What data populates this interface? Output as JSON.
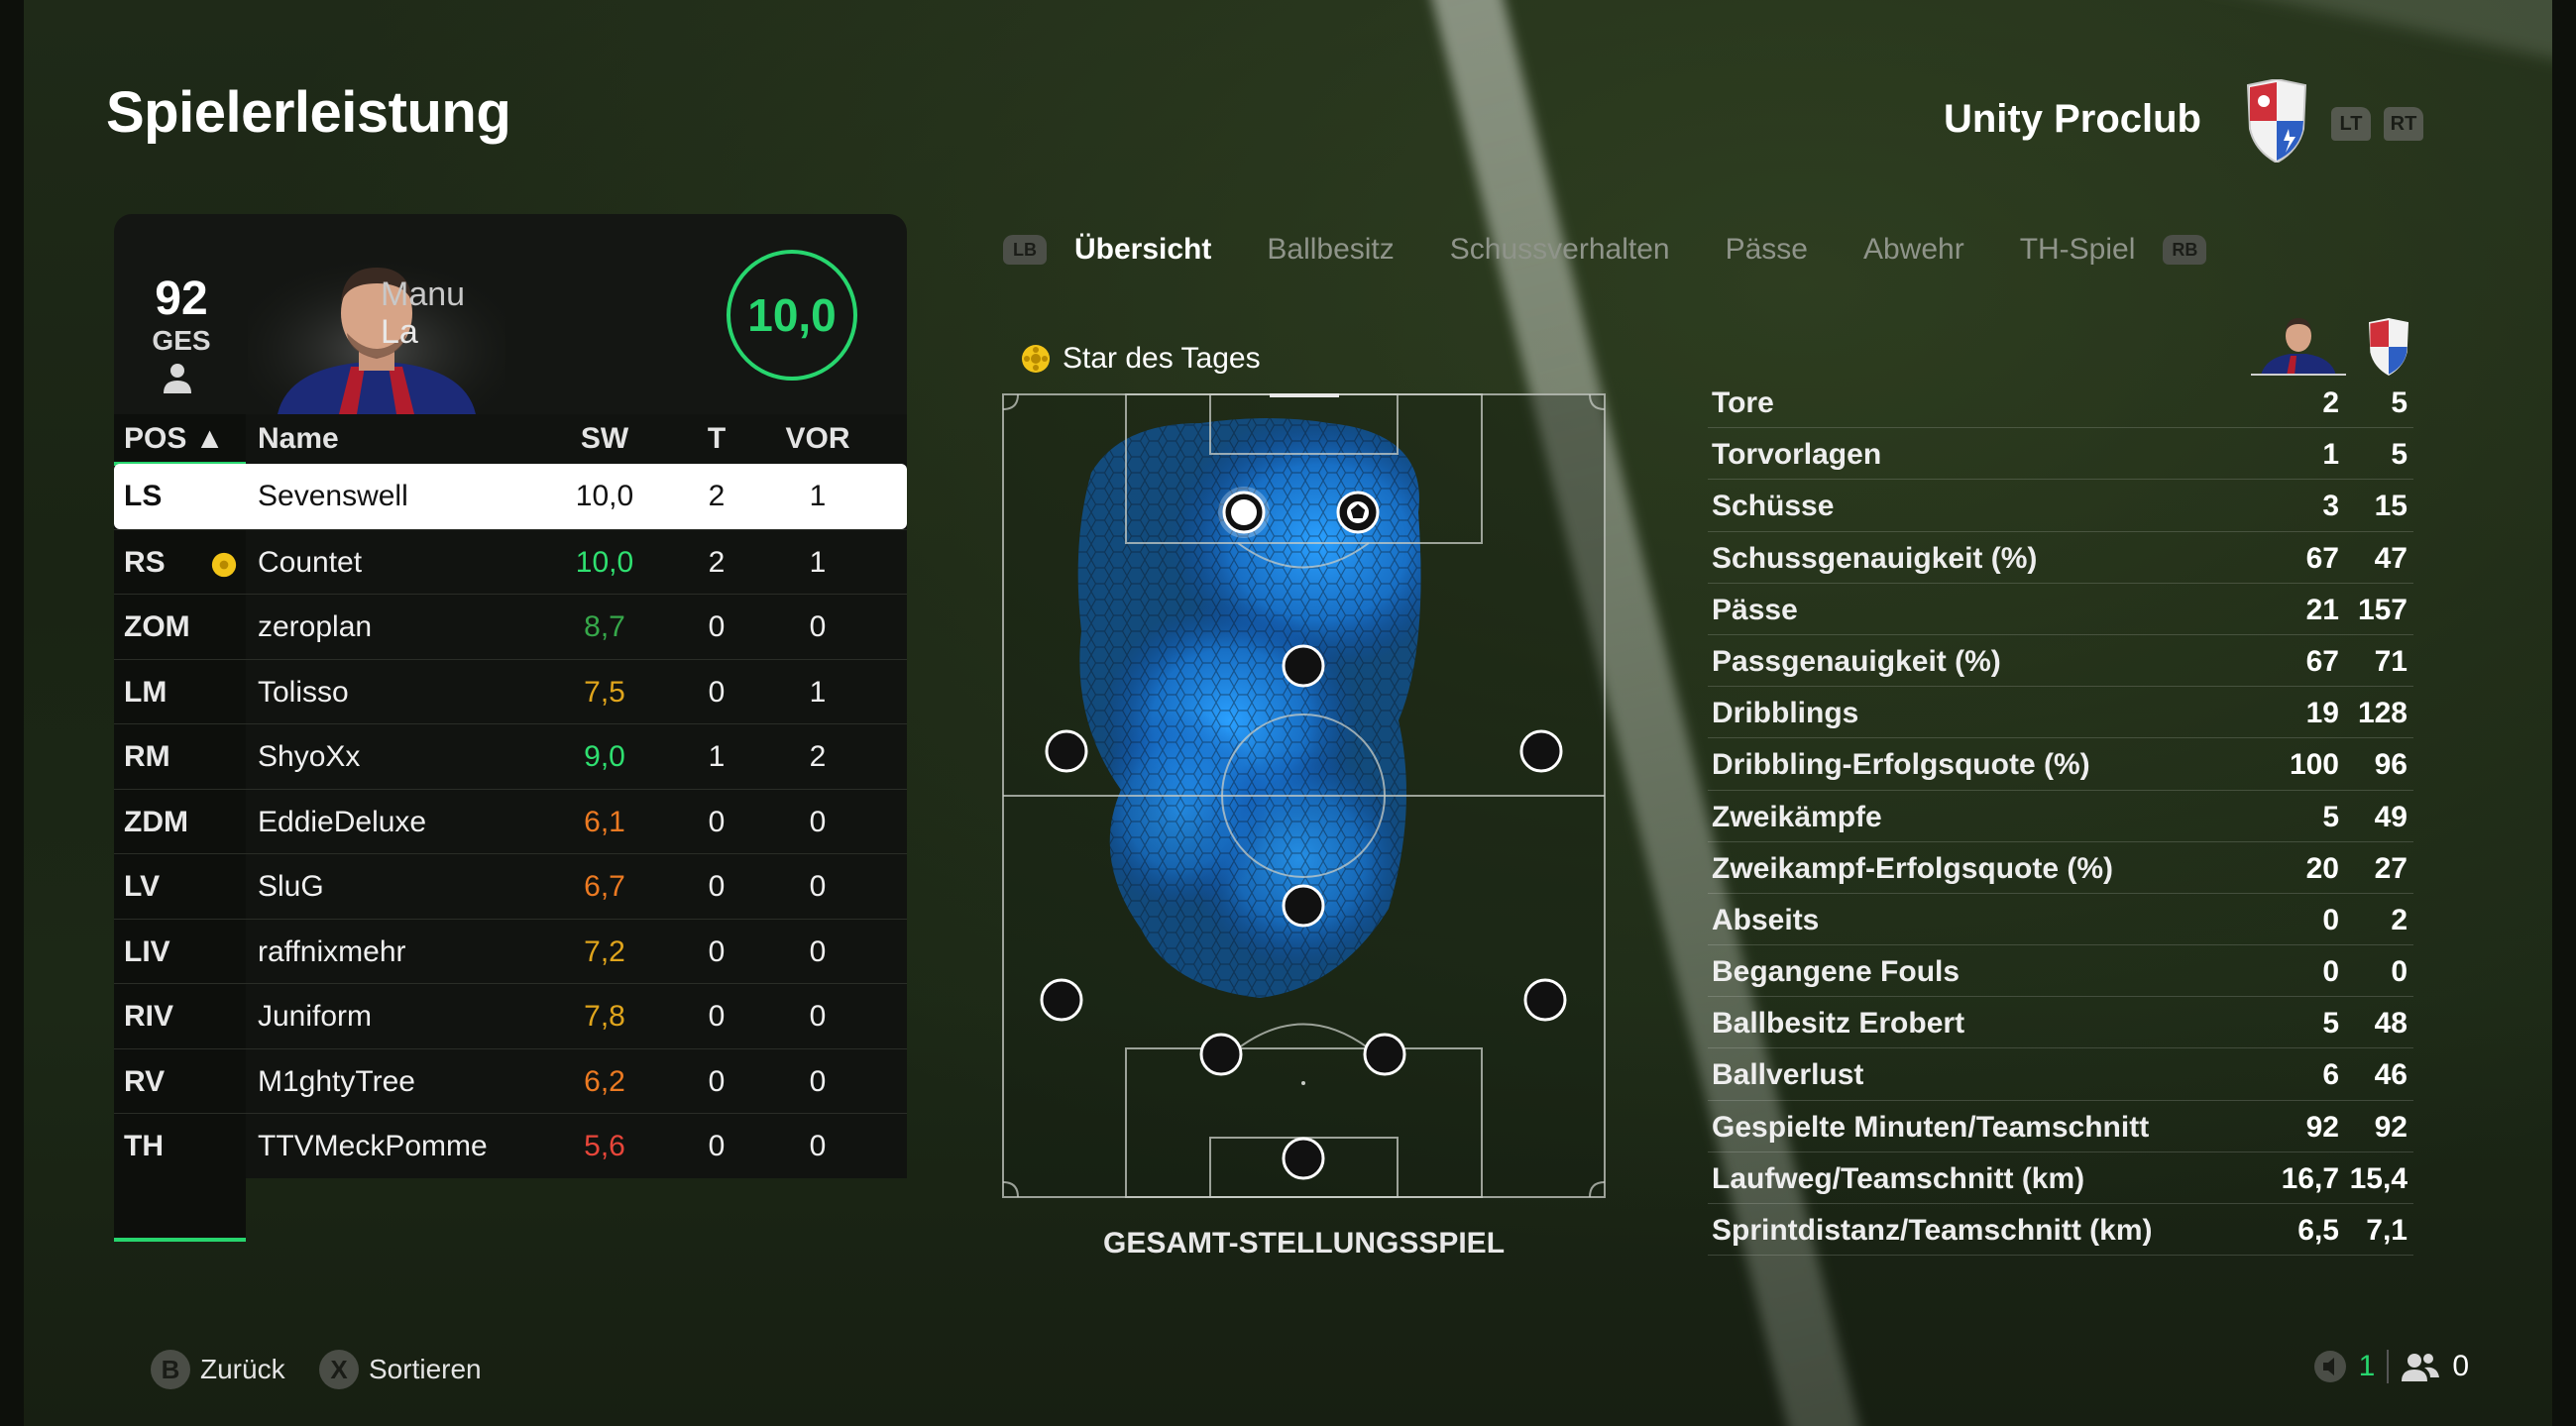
{
  "header": {
    "title": "Spielerleistung",
    "club_name": "Unity Proclub",
    "trigger_left": "LT",
    "trigger_right": "RT"
  },
  "player_card": {
    "overall": "92",
    "overall_label": "GES",
    "first_name": "Manu",
    "last_name": "La",
    "rating": "10,0"
  },
  "table": {
    "headers": {
      "pos": "POS ▲",
      "name": "Name",
      "sw": "SW",
      "t": "T",
      "vor": "VOR"
    },
    "rows": [
      {
        "pos": "LS",
        "name": "Sevenswell",
        "sw": "10,0",
        "t": "2",
        "vor": "1",
        "color": "#111111",
        "selected": true
      },
      {
        "pos": "RS",
        "name": "Countet",
        "sw": "10,0",
        "t": "2",
        "vor": "1",
        "color": "#2fe070",
        "star": true
      },
      {
        "pos": "ZOM",
        "name": "zeroplan",
        "sw": "8,7",
        "t": "0",
        "vor": "0",
        "color": "#36a84a"
      },
      {
        "pos": "LM",
        "name": "Tolisso",
        "sw": "7,5",
        "t": "0",
        "vor": "1",
        "color": "#e0a51c"
      },
      {
        "pos": "RM",
        "name": "ShyoXx",
        "sw": "9,0",
        "t": "1",
        "vor": "2",
        "color": "#2fe070"
      },
      {
        "pos": "ZDM",
        "name": "EddieDeluxe",
        "sw": "6,1",
        "t": "0",
        "vor": "0",
        "color": "#ec7a22"
      },
      {
        "pos": "LV",
        "name": "SluG",
        "sw": "6,7",
        "t": "0",
        "vor": "0",
        "color": "#ec7a22"
      },
      {
        "pos": "LIV",
        "name": "raffnixmehr",
        "sw": "7,2",
        "t": "0",
        "vor": "0",
        "color": "#e0a51c"
      },
      {
        "pos": "RIV",
        "name": "Juniform",
        "sw": "7,8",
        "t": "0",
        "vor": "0",
        "color": "#e0a51c"
      },
      {
        "pos": "RV",
        "name": "M1ghtyTree",
        "sw": "6,2",
        "t": "0",
        "vor": "0",
        "color": "#ec7a22"
      },
      {
        "pos": "TH",
        "name": "TTVMeckPomme",
        "sw": "5,6",
        "t": "0",
        "vor": "0",
        "color": "#e8463a"
      }
    ]
  },
  "tabs": {
    "bumper_left": "LB",
    "bumper_right": "RB",
    "items": [
      {
        "label": "Übersicht",
        "active": true
      },
      {
        "label": "Ballbesitz"
      },
      {
        "label": "Schussverhalten"
      },
      {
        "label": "Pässe"
      },
      {
        "label": "Abwehr"
      },
      {
        "label": "TH-Spiel"
      }
    ]
  },
  "pitch": {
    "star_label": "Star des Tages",
    "caption": "GESAMT-STELLUNGSSPIEL"
  },
  "stats": [
    {
      "label": "Tore",
      "player": "2",
      "team": "5"
    },
    {
      "label": "Torvorlagen",
      "player": "1",
      "team": "5"
    },
    {
      "label": "Schüsse",
      "player": "3",
      "team": "15"
    },
    {
      "label": "Schussgenauigkeit (%)",
      "player": "67",
      "team": "47"
    },
    {
      "label": "Pässe",
      "player": "21",
      "team": "157"
    },
    {
      "label": "Passgenauigkeit (%)",
      "player": "67",
      "team": "71"
    },
    {
      "label": "Dribblings",
      "player": "19",
      "team": "128"
    },
    {
      "label": "Dribbling-Erfolgsquote (%)",
      "player": "100",
      "team": "96"
    },
    {
      "label": "Zweikämpfe",
      "player": "5",
      "team": "49"
    },
    {
      "label": "Zweikampf-Erfolgsquote (%)",
      "player": "20",
      "team": "27"
    },
    {
      "label": "Abseits",
      "player": "0",
      "team": "2"
    },
    {
      "label": "Begangene Fouls",
      "player": "0",
      "team": "0"
    },
    {
      "label": "Ballbesitz Erobert",
      "player": "5",
      "team": "48"
    },
    {
      "label": "Ballverlust",
      "player": "6",
      "team": "46"
    },
    {
      "label": "Gespielte Minuten/Teamschnitt",
      "player": "92",
      "team": "92"
    },
    {
      "label": "Laufweg/Teamschnitt (km)",
      "player": "16,7",
      "team": "15,4"
    },
    {
      "label": "Sprintdistanz/Teamschnitt (km)",
      "player": "6,5",
      "team": "7,1"
    }
  ],
  "footer": {
    "back_key": "B",
    "back_label": "Zurück",
    "sort_key": "X",
    "sort_label": "Sortieren",
    "voice_count": "1",
    "party_count": "0"
  },
  "colors": {
    "accent": "#27d66e",
    "heat": "#1e90ff"
  }
}
